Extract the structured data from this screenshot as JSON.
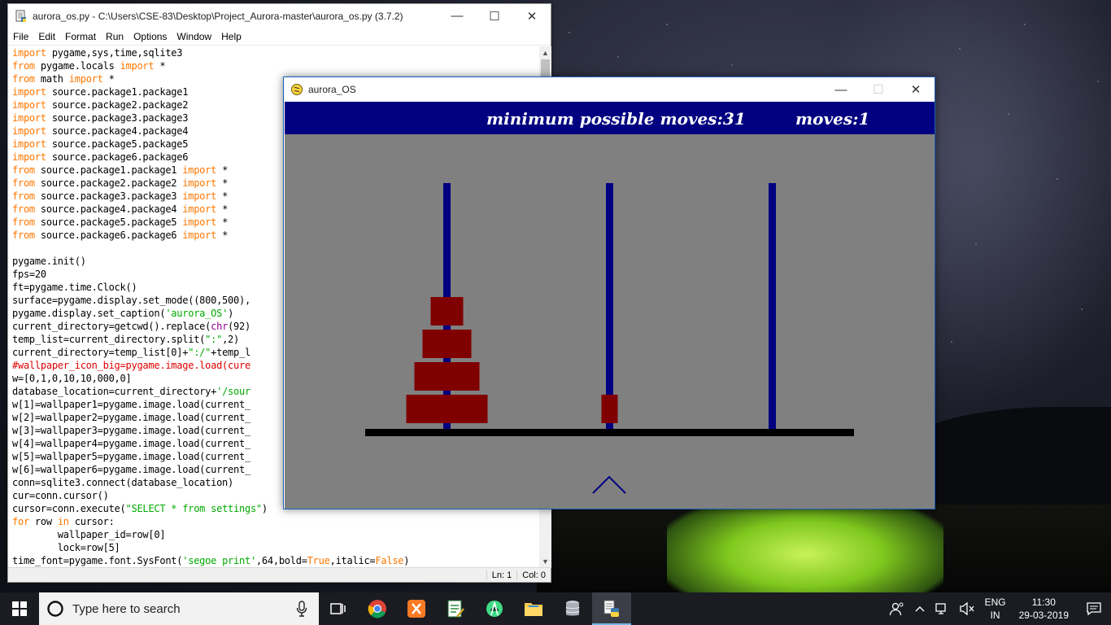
{
  "editor": {
    "title": "aurora_os.py - C:\\Users\\CSE-83\\Desktop\\Project_Aurora-master\\aurora_os.py (3.7.2)",
    "menu": [
      "File",
      "Edit",
      "Format",
      "Run",
      "Options",
      "Window",
      "Help"
    ],
    "code_lines": [
      [
        [
          "kw",
          "import"
        ],
        [
          "",
          " pygame,sys,time,sqlite3"
        ]
      ],
      [
        [
          "kw",
          "from"
        ],
        [
          "",
          " pygame.locals "
        ],
        [
          "kw",
          "import"
        ],
        [
          "",
          " *"
        ]
      ],
      [
        [
          "kw",
          "from"
        ],
        [
          "",
          " math "
        ],
        [
          "kw",
          "import"
        ],
        [
          "",
          " *"
        ]
      ],
      [
        [
          "kw",
          "import"
        ],
        [
          "",
          " source.package1.package1"
        ]
      ],
      [
        [
          "kw",
          "import"
        ],
        [
          "",
          " source.package2.package2"
        ]
      ],
      [
        [
          "kw",
          "import"
        ],
        [
          "",
          " source.package3.package3"
        ]
      ],
      [
        [
          "kw",
          "import"
        ],
        [
          "",
          " source.package4.package4"
        ]
      ],
      [
        [
          "kw",
          "import"
        ],
        [
          "",
          " source.package5.package5"
        ]
      ],
      [
        [
          "kw",
          "import"
        ],
        [
          "",
          " source.package6.package6"
        ]
      ],
      [
        [
          "kw",
          "from"
        ],
        [
          "",
          " source.package1.package1 "
        ],
        [
          "kw",
          "import"
        ],
        [
          "",
          " *"
        ]
      ],
      [
        [
          "kw",
          "from"
        ],
        [
          "",
          " source.package2.package2 "
        ],
        [
          "kw",
          "import"
        ],
        [
          "",
          " *"
        ]
      ],
      [
        [
          "kw",
          "from"
        ],
        [
          "",
          " source.package3.package3 "
        ],
        [
          "kw",
          "import"
        ],
        [
          "",
          " *"
        ]
      ],
      [
        [
          "kw",
          "from"
        ],
        [
          "",
          " source.package4.package4 "
        ],
        [
          "kw",
          "import"
        ],
        [
          "",
          " *"
        ]
      ],
      [
        [
          "kw",
          "from"
        ],
        [
          "",
          " source.package5.package5 "
        ],
        [
          "kw",
          "import"
        ],
        [
          "",
          " *"
        ]
      ],
      [
        [
          "kw",
          "from"
        ],
        [
          "",
          " source.package6.package6 "
        ],
        [
          "kw",
          "import"
        ],
        [
          "",
          " *"
        ]
      ],
      [],
      [
        [
          "",
          "pygame.init()"
        ]
      ],
      [
        [
          "",
          "fps=20"
        ]
      ],
      [
        [
          "",
          "ft=pygame.time.Clock()"
        ]
      ],
      [
        [
          "",
          "surface=pygame.display.set_mode((800,500),"
        ]
      ],
      [
        [
          "",
          "pygame.display.set_caption("
        ],
        [
          "str",
          "'aurora_OS'"
        ],
        [
          "",
          ")"
        ]
      ],
      [
        [
          "",
          "current_directory=getcwd().replace("
        ],
        [
          "bi",
          "chr"
        ],
        [
          "",
          "(92)"
        ]
      ],
      [
        [
          "",
          "temp_list=current_directory.split("
        ],
        [
          "str",
          "\":\""
        ],
        [
          "",
          ",2)"
        ]
      ],
      [
        [
          "",
          "current_directory=temp_list[0]+"
        ],
        [
          "str",
          "\":/\""
        ],
        [
          "",
          "+temp_l"
        ]
      ],
      [
        [
          "cm",
          "#wallpaper_icon_big=pygame.image.load(cure"
        ]
      ],
      [
        [
          "",
          "w=[0,1,0,10,10,000,0]"
        ]
      ],
      [
        [
          "",
          "database_location=current_directory+"
        ],
        [
          "str",
          "'/sour"
        ]
      ],
      [
        [
          "",
          "w[1]=wallpaper1=pygame.image.load(current_"
        ]
      ],
      [
        [
          "",
          "w[2]=wallpaper2=pygame.image.load(current_"
        ]
      ],
      [
        [
          "",
          "w[3]=wallpaper3=pygame.image.load(current_"
        ]
      ],
      [
        [
          "",
          "w[4]=wallpaper4=pygame.image.load(current_"
        ]
      ],
      [
        [
          "",
          "w[5]=wallpaper5=pygame.image.load(current_"
        ]
      ],
      [
        [
          "",
          "w[6]=wallpaper6=pygame.image.load(current_"
        ]
      ],
      [
        [
          "",
          "conn=sqlite3.connect(database_location)"
        ]
      ],
      [
        [
          "",
          "cur=conn.cursor()"
        ]
      ],
      [
        [
          "",
          "cursor=conn.execute("
        ],
        [
          "str",
          "\"SELECT * from settings\""
        ],
        [
          "",
          ")"
        ]
      ],
      [
        [
          "kw",
          "for"
        ],
        [
          "",
          " row "
        ],
        [
          "kw",
          "in"
        ],
        [
          "",
          " cursor:"
        ]
      ],
      [
        [
          "",
          "        wallpaper_id=row[0]"
        ]
      ],
      [
        [
          "",
          "        lock=row[5]"
        ]
      ],
      [
        [
          "",
          "time_font=pygame.font.SysFont("
        ],
        [
          "str",
          "'segoe print'"
        ],
        [
          "",
          ",64,bold="
        ],
        [
          "kw",
          "True"
        ],
        [
          "",
          ",italic="
        ],
        [
          "kw",
          "False"
        ],
        [
          "",
          ")"
        ]
      ]
    ],
    "status": {
      "line": "Ln: 1",
      "col": "Col: 0"
    }
  },
  "game": {
    "title": "aurora_OS",
    "min_moves_label": "minimum possible moves:31",
    "moves_label": "moves:1",
    "colors": {
      "header": "#000080",
      "board": "#808080",
      "peg": "#000080",
      "disk": "#800000",
      "base": "#000000"
    },
    "pegs": [
      {
        "name": "peg-left",
        "disks": [
          4,
          3,
          2,
          1
        ]
      },
      {
        "name": "peg-middle",
        "disks": [
          0
        ]
      },
      {
        "name": "peg-right",
        "disks": []
      }
    ],
    "selector_peg": 1
  },
  "taskbar": {
    "search_placeholder": "Type here to search",
    "apps": [
      "task-view-icon",
      "chrome-icon",
      "xampp-icon",
      "notepad-icon",
      "android-studio-icon",
      "file-explorer-icon",
      "database-icon",
      "python-idle-icon"
    ],
    "lang_top": "ENG",
    "lang_bottom": "IN",
    "time": "11:30",
    "date": "29-03-2019"
  }
}
